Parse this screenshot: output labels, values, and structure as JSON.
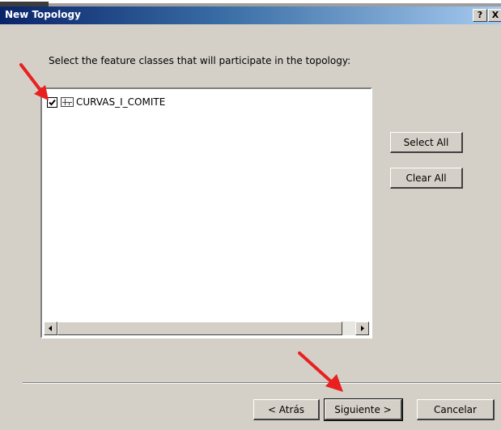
{
  "window": {
    "title": "New Topology",
    "help_button": "?",
    "close_button": "X"
  },
  "instruction": "Select the feature classes that will participate in the topology:",
  "feature_classes": [
    {
      "label": "CURVAS_I_COMITE",
      "checked": true,
      "icon": "line-feature-class-icon"
    }
  ],
  "side_buttons": {
    "select_all": "Select All",
    "clear_all": "Clear All"
  },
  "footer_buttons": {
    "back": "< Atrás",
    "next": "Siguiente >",
    "cancel": "Cancelar"
  },
  "annotations": {
    "arrow_color": "#e82020",
    "arrows": [
      "red-arrow-icon",
      "red-arrow-icon"
    ]
  },
  "colors": {
    "dialog_bg": "#d4d0c8",
    "titlebar_start": "#0a246a",
    "titlebar_end": "#a6caf0"
  }
}
